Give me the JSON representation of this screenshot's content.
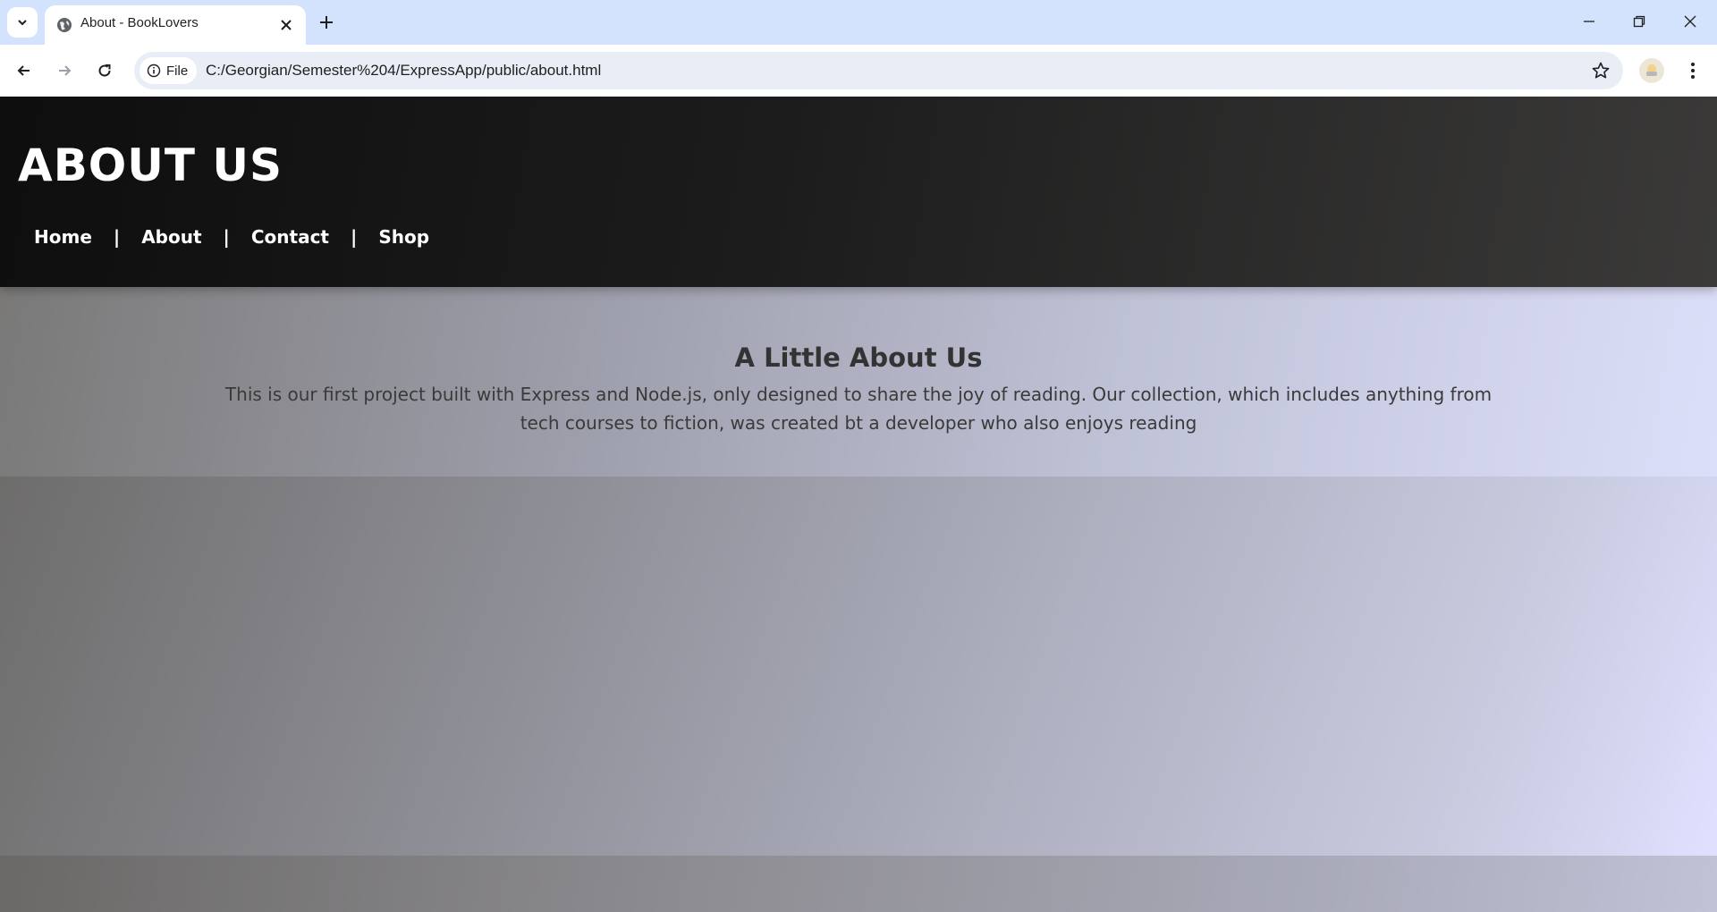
{
  "browser": {
    "tab": {
      "title": "About - BookLovers"
    },
    "omnibox": {
      "chip_label": "File",
      "url": "C:/Georgian/Semester%204/ExpressApp/public/about.html"
    }
  },
  "page": {
    "header": {
      "title": "ABOUT US",
      "nav": [
        {
          "label": "Home"
        },
        {
          "label": "About"
        },
        {
          "label": "Contact"
        },
        {
          "label": "Shop"
        }
      ],
      "separator": "|"
    },
    "about": {
      "heading": "A Little About Us",
      "text": "This is our first project built with Express and Node.js, only designed to share the joy of reading. Our collection, which includes anything from tech courses to fiction, was created bt a developer who also enjoys reading"
    }
  },
  "colors": {
    "chrome_tabstrip": "#d3e3fd",
    "header_dark": "#111111",
    "section_light": "#dcdff9"
  }
}
